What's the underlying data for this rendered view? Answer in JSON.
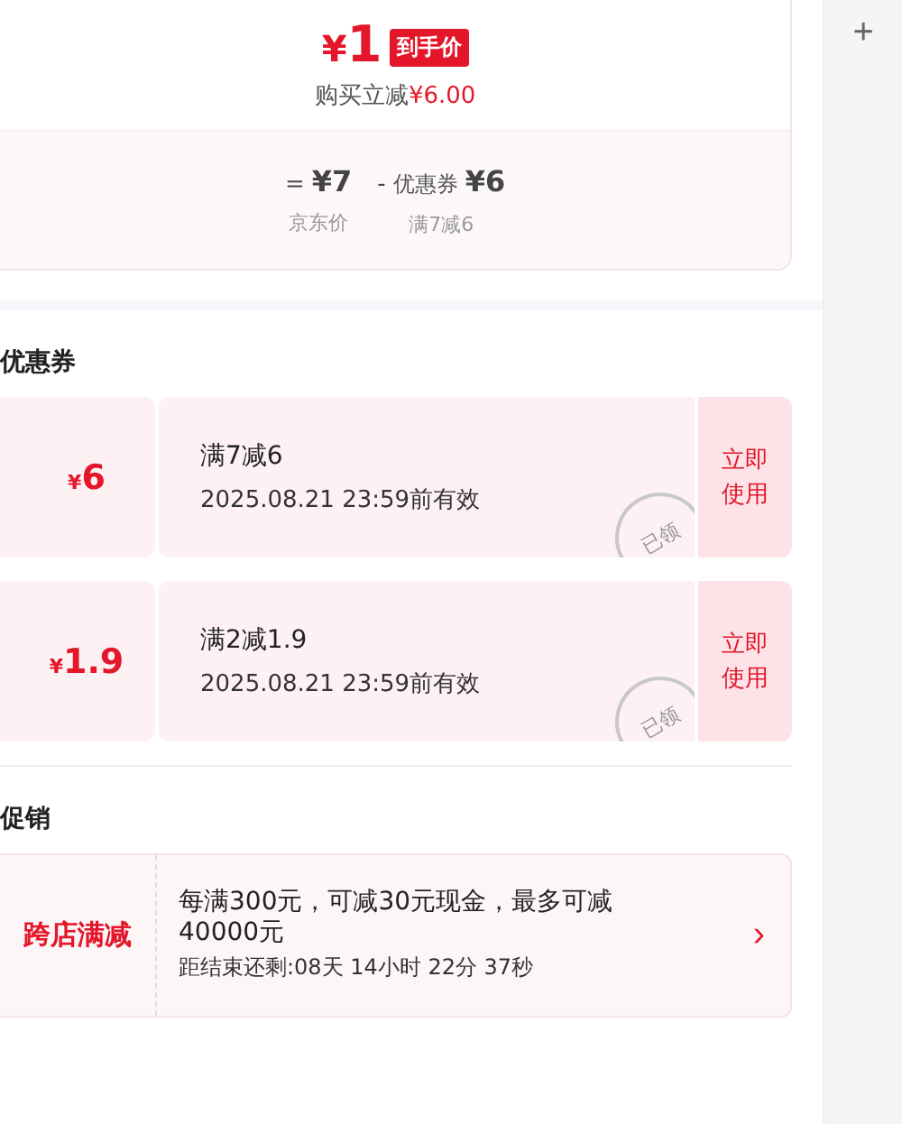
{
  "price_card": {
    "currency": "¥",
    "price": "1",
    "badge": "到手价",
    "saving_label": "购买立减",
    "saving_amount": "¥6.00",
    "breakdown": [
      {
        "operator": "=",
        "value": "¥7",
        "label": "京东价"
      },
      {
        "operator": "-",
        "name": "优惠券",
        "value": "¥6",
        "label": "满7减6"
      }
    ]
  },
  "coupons": {
    "title": "优惠券",
    "items": [
      {
        "currency": "¥",
        "amount": "6",
        "condition": "满7减6",
        "validity": "2025.08.21 23:59前有效",
        "claimed": true,
        "stamp": "已领",
        "action": "立即使用"
      },
      {
        "currency": "¥",
        "amount": "1.9",
        "condition": "满2减1.9",
        "validity": "2025.08.21 23:59前有效",
        "claimed": true,
        "stamp": "已领",
        "action": "立即使用"
      }
    ]
  },
  "promotions": {
    "title": "促销",
    "items": [
      {
        "label": "跨店满减",
        "description": "每满300元，可减30元现金，最多可减40000元",
        "countdown": "距结束还剩:08天 14小时 22分 37秒",
        "chevron": "›"
      }
    ]
  },
  "side_panel": {
    "add": "+"
  }
}
